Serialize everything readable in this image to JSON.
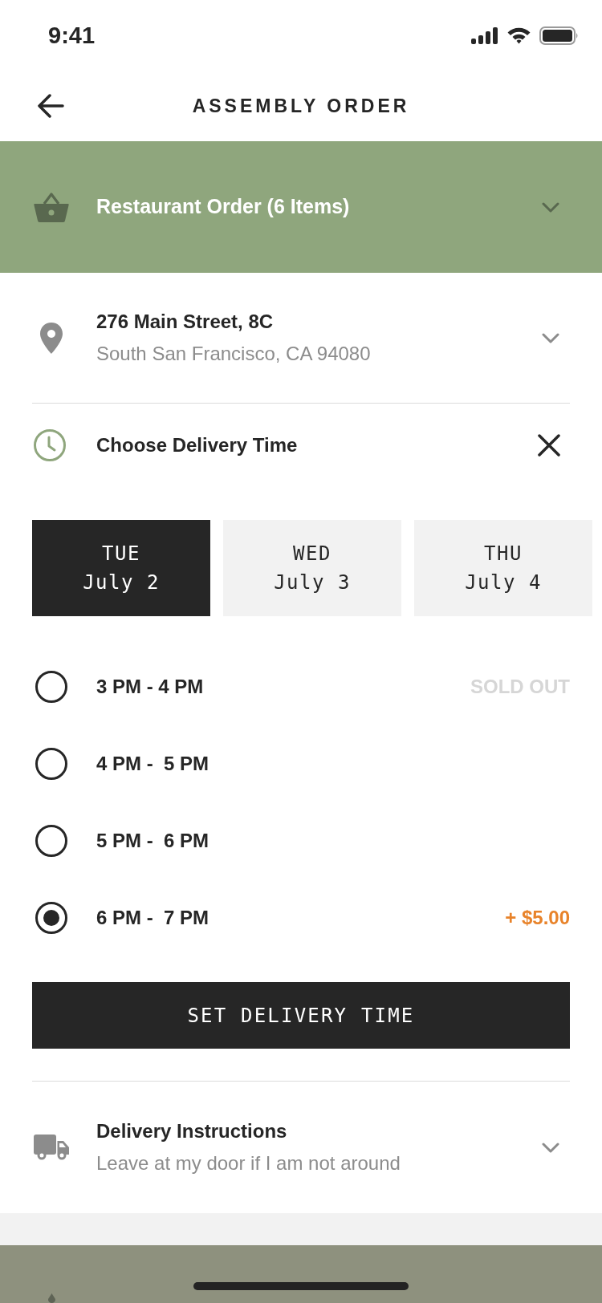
{
  "status_bar": {
    "time": "9:41"
  },
  "header": {
    "title": "ASSEMBLY ORDER"
  },
  "order_summary": {
    "label": "Restaurant Order (6 Items)"
  },
  "address": {
    "line_1": "276 Main Street, 8C",
    "line_2": "South San Francisco, CA 94080"
  },
  "delivery_time": {
    "title": "Choose Delivery Time",
    "days": [
      {
        "weekday": "TUE",
        "date": "July 2",
        "selected": true
      },
      {
        "weekday": "WED",
        "date": "July 3",
        "selected": false
      },
      {
        "weekday": "THU",
        "date": "July 4",
        "selected": false
      }
    ],
    "slots": [
      {
        "label": "3 PM - 4 PM",
        "selected": false,
        "note": {
          "kind": "sold_out",
          "text": "SOLD OUT"
        }
      },
      {
        "label": "4 PM -  5 PM",
        "selected": false
      },
      {
        "label": "5 PM -  6 PM",
        "selected": false
      },
      {
        "label": "6 PM -  7 PM",
        "selected": true,
        "note": {
          "kind": "surcharge",
          "text": "+ $5.00"
        }
      }
    ],
    "button": "SET DELIVERY TIME"
  },
  "delivery_instructions": {
    "title": "Delivery Instructions",
    "text": "Leave at my door if I am not around"
  }
}
